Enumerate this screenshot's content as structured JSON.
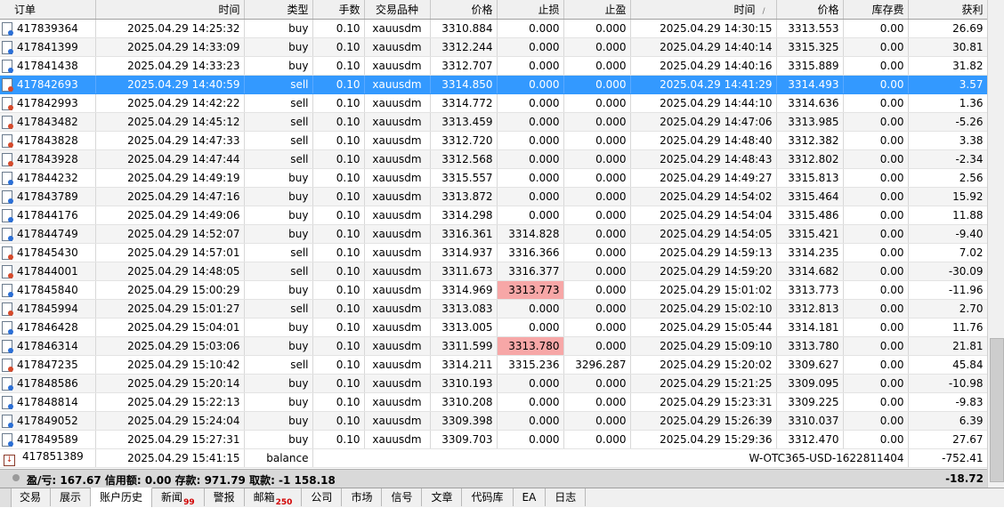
{
  "headers": [
    "订单",
    "时间",
    "类型",
    "手数",
    "交易品种",
    "价格",
    "止损",
    "止盈",
    "时间",
    "价格",
    "库存费",
    "获利"
  ],
  "sort_indicator": "/",
  "rows": [
    {
      "ticket": "417839364",
      "open_time": "2025.04.29 14:25:32",
      "type": "buy",
      "lots": "0.10",
      "symbol": "xauusdm",
      "open_price": "3310.884",
      "sl": "0.000",
      "tp": "0.000",
      "close_time": "2025.04.29 14:30:15",
      "close_price": "3313.553",
      "swap": "0.00",
      "profit": "26.69"
    },
    {
      "ticket": "417841399",
      "open_time": "2025.04.29 14:33:09",
      "type": "buy",
      "lots": "0.10",
      "symbol": "xauusdm",
      "open_price": "3312.244",
      "sl": "0.000",
      "tp": "0.000",
      "close_time": "2025.04.29 14:40:14",
      "close_price": "3315.325",
      "swap": "0.00",
      "profit": "30.81"
    },
    {
      "ticket": "417841438",
      "open_time": "2025.04.29 14:33:23",
      "type": "buy",
      "lots": "0.10",
      "symbol": "xauusdm",
      "open_price": "3312.707",
      "sl": "0.000",
      "tp": "0.000",
      "close_time": "2025.04.29 14:40:16",
      "close_price": "3315.889",
      "swap": "0.00",
      "profit": "31.82"
    },
    {
      "ticket": "417842693",
      "open_time": "2025.04.29 14:40:59",
      "type": "sell",
      "lots": "0.10",
      "symbol": "xauusdm",
      "open_price": "3314.850",
      "sl": "0.000",
      "tp": "0.000",
      "close_time": "2025.04.29 14:41:29",
      "close_price": "3314.493",
      "swap": "0.00",
      "profit": "3.57",
      "selected": true
    },
    {
      "ticket": "417842993",
      "open_time": "2025.04.29 14:42:22",
      "type": "sell",
      "lots": "0.10",
      "symbol": "xauusdm",
      "open_price": "3314.772",
      "sl": "0.000",
      "tp": "0.000",
      "close_time": "2025.04.29 14:44:10",
      "close_price": "3314.636",
      "swap": "0.00",
      "profit": "1.36"
    },
    {
      "ticket": "417843482",
      "open_time": "2025.04.29 14:45:12",
      "type": "sell",
      "lots": "0.10",
      "symbol": "xauusdm",
      "open_price": "3313.459",
      "sl": "0.000",
      "tp": "0.000",
      "close_time": "2025.04.29 14:47:06",
      "close_price": "3313.985",
      "swap": "0.00",
      "profit": "-5.26"
    },
    {
      "ticket": "417843828",
      "open_time": "2025.04.29 14:47:33",
      "type": "sell",
      "lots": "0.10",
      "symbol": "xauusdm",
      "open_price": "3312.720",
      "sl": "0.000",
      "tp": "0.000",
      "close_time": "2025.04.29 14:48:40",
      "close_price": "3312.382",
      "swap": "0.00",
      "profit": "3.38"
    },
    {
      "ticket": "417843928",
      "open_time": "2025.04.29 14:47:44",
      "type": "sell",
      "lots": "0.10",
      "symbol": "xauusdm",
      "open_price": "3312.568",
      "sl": "0.000",
      "tp": "0.000",
      "close_time": "2025.04.29 14:48:43",
      "close_price": "3312.802",
      "swap": "0.00",
      "profit": "-2.34"
    },
    {
      "ticket": "417844232",
      "open_time": "2025.04.29 14:49:19",
      "type": "buy",
      "lots": "0.10",
      "symbol": "xauusdm",
      "open_price": "3315.557",
      "sl": "0.000",
      "tp": "0.000",
      "close_time": "2025.04.29 14:49:27",
      "close_price": "3315.813",
      "swap": "0.00",
      "profit": "2.56"
    },
    {
      "ticket": "417843789",
      "open_time": "2025.04.29 14:47:16",
      "type": "buy",
      "lots": "0.10",
      "symbol": "xauusdm",
      "open_price": "3313.872",
      "sl": "0.000",
      "tp": "0.000",
      "close_time": "2025.04.29 14:54:02",
      "close_price": "3315.464",
      "swap": "0.00",
      "profit": "15.92"
    },
    {
      "ticket": "417844176",
      "open_time": "2025.04.29 14:49:06",
      "type": "buy",
      "lots": "0.10",
      "symbol": "xauusdm",
      "open_price": "3314.298",
      "sl": "0.000",
      "tp": "0.000",
      "close_time": "2025.04.29 14:54:04",
      "close_price": "3315.486",
      "swap": "0.00",
      "profit": "11.88"
    },
    {
      "ticket": "417844749",
      "open_time": "2025.04.29 14:52:07",
      "type": "buy",
      "lots": "0.10",
      "symbol": "xauusdm",
      "open_price": "3316.361",
      "sl": "3314.828",
      "tp": "0.000",
      "close_time": "2025.04.29 14:54:05",
      "close_price": "3315.421",
      "swap": "0.00",
      "profit": "-9.40"
    },
    {
      "ticket": "417845430",
      "open_time": "2025.04.29 14:57:01",
      "type": "sell",
      "lots": "0.10",
      "symbol": "xauusdm",
      "open_price": "3314.937",
      "sl": "3316.366",
      "tp": "0.000",
      "close_time": "2025.04.29 14:59:13",
      "close_price": "3314.235",
      "swap": "0.00",
      "profit": "7.02"
    },
    {
      "ticket": "417844001",
      "open_time": "2025.04.29 14:48:05",
      "type": "sell",
      "lots": "0.10",
      "symbol": "xauusdm",
      "open_price": "3311.673",
      "sl": "3316.377",
      "tp": "0.000",
      "close_time": "2025.04.29 14:59:20",
      "close_price": "3314.682",
      "swap": "0.00",
      "profit": "-30.09"
    },
    {
      "ticket": "417845840",
      "open_time": "2025.04.29 15:00:29",
      "type": "buy",
      "lots": "0.10",
      "symbol": "xauusdm",
      "open_price": "3314.969",
      "sl": "3313.773",
      "tp": "0.000",
      "close_time": "2025.04.29 15:01:02",
      "close_price": "3313.773",
      "swap": "0.00",
      "profit": "-11.96",
      "sl_hit": true
    },
    {
      "ticket": "417845994",
      "open_time": "2025.04.29 15:01:27",
      "type": "sell",
      "lots": "0.10",
      "symbol": "xauusdm",
      "open_price": "3313.083",
      "sl": "0.000",
      "tp": "0.000",
      "close_time": "2025.04.29 15:02:10",
      "close_price": "3312.813",
      "swap": "0.00",
      "profit": "2.70"
    },
    {
      "ticket": "417846428",
      "open_time": "2025.04.29 15:04:01",
      "type": "buy",
      "lots": "0.10",
      "symbol": "xauusdm",
      "open_price": "3313.005",
      "sl": "0.000",
      "tp": "0.000",
      "close_time": "2025.04.29 15:05:44",
      "close_price": "3314.181",
      "swap": "0.00",
      "profit": "11.76"
    },
    {
      "ticket": "417846314",
      "open_time": "2025.04.29 15:03:06",
      "type": "buy",
      "lots": "0.10",
      "symbol": "xauusdm",
      "open_price": "3311.599",
      "sl": "3313.780",
      "tp": "0.000",
      "close_time": "2025.04.29 15:09:10",
      "close_price": "3313.780",
      "swap": "0.00",
      "profit": "21.81",
      "sl_hit": true
    },
    {
      "ticket": "417847235",
      "open_time": "2025.04.29 15:10:42",
      "type": "sell",
      "lots": "0.10",
      "symbol": "xauusdm",
      "open_price": "3314.211",
      "sl": "3315.236",
      "tp": "3296.287",
      "close_time": "2025.04.29 15:20:02",
      "close_price": "3309.627",
      "swap": "0.00",
      "profit": "45.84"
    },
    {
      "ticket": "417848586",
      "open_time": "2025.04.29 15:20:14",
      "type": "buy",
      "lots": "0.10",
      "symbol": "xauusdm",
      "open_price": "3310.193",
      "sl": "0.000",
      "tp": "0.000",
      "close_time": "2025.04.29 15:21:25",
      "close_price": "3309.095",
      "swap": "0.00",
      "profit": "-10.98"
    },
    {
      "ticket": "417848814",
      "open_time": "2025.04.29 15:22:13",
      "type": "buy",
      "lots": "0.10",
      "symbol": "xauusdm",
      "open_price": "3310.208",
      "sl": "0.000",
      "tp": "0.000",
      "close_time": "2025.04.29 15:23:31",
      "close_price": "3309.225",
      "swap": "0.00",
      "profit": "-9.83"
    },
    {
      "ticket": "417849052",
      "open_time": "2025.04.29 15:24:04",
      "type": "buy",
      "lots": "0.10",
      "symbol": "xauusdm",
      "open_price": "3309.398",
      "sl": "0.000",
      "tp": "0.000",
      "close_time": "2025.04.29 15:26:39",
      "close_price": "3310.037",
      "swap": "0.00",
      "profit": "6.39"
    },
    {
      "ticket": "417849589",
      "open_time": "2025.04.29 15:27:31",
      "type": "buy",
      "lots": "0.10",
      "symbol": "xauusdm",
      "open_price": "3309.703",
      "sl": "0.000",
      "tp": "0.000",
      "close_time": "2025.04.29 15:29:36",
      "close_price": "3312.470",
      "swap": "0.00",
      "profit": "27.67"
    }
  ],
  "balance_row": {
    "ticket": "417851389",
    "time": "2025.04.29 15:41:15",
    "type": "balance",
    "comment": "W-OTC365-USD-1622811404",
    "profit": "-752.41"
  },
  "summary": {
    "text": "盈/亏: 167.67  信用额: 0.00  存款: 971.79  取款: -1 158.18",
    "total": "-18.72"
  },
  "tabs": [
    {
      "label": "交易"
    },
    {
      "label": "展示"
    },
    {
      "label": "账户历史",
      "active": true
    },
    {
      "label": "新闻",
      "badge": "99"
    },
    {
      "label": "警报"
    },
    {
      "label": "邮箱",
      "badge": "250"
    },
    {
      "label": "公司"
    },
    {
      "label": "市场"
    },
    {
      "label": "信号"
    },
    {
      "label": "文章"
    },
    {
      "label": "代码库"
    },
    {
      "label": "EA"
    },
    {
      "label": "日志"
    }
  ],
  "colors": {
    "selection": "#3399ff",
    "sl_hit": "#f7a7a7",
    "header_bg": "#f0f0f0",
    "alt_row": "#f4f4f4"
  }
}
